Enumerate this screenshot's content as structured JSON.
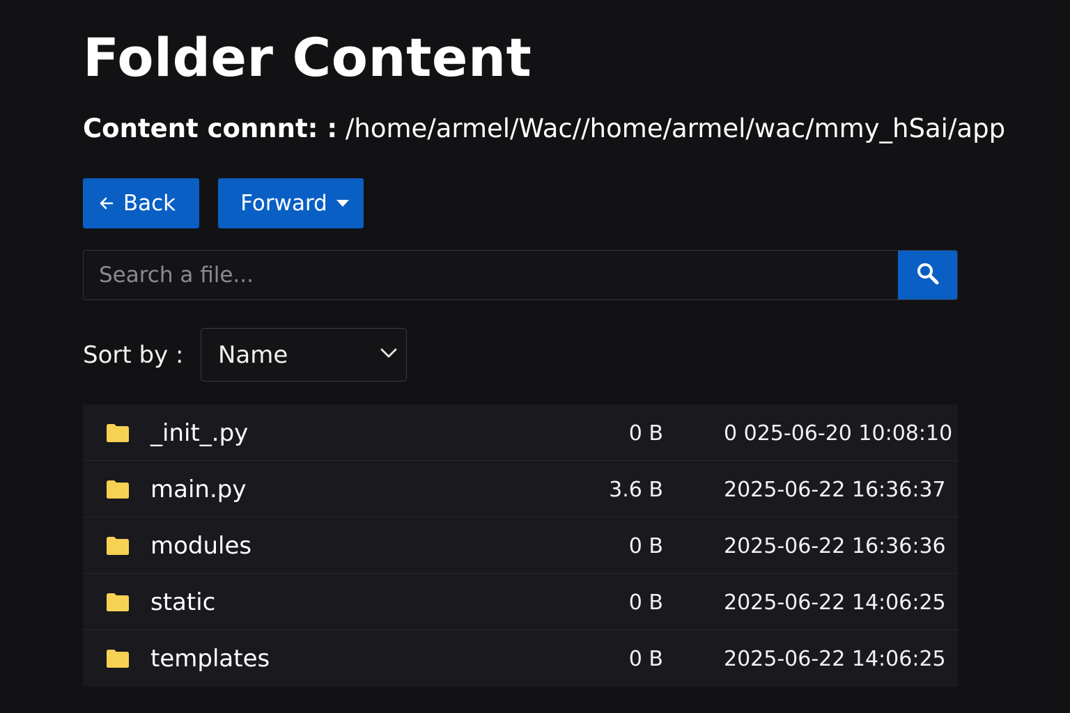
{
  "title": "Folder Content",
  "path": {
    "label": "Content connnt: :",
    "value": "/home/armel/Wac//home/armel/wac/mmy_hSai/app"
  },
  "nav": {
    "back_label": "Back",
    "forward_label": "Forward"
  },
  "search": {
    "placeholder": "Search a file...",
    "value": ""
  },
  "sort": {
    "label": "Sort by :",
    "selected": "Name"
  },
  "files": [
    {
      "icon": "folder-icon",
      "name": "_init_.py",
      "size": "0 B",
      "modified": "0 025-06-20 10:08:10"
    },
    {
      "icon": "folder-icon",
      "name": "main.py",
      "size": "3.6 B",
      "modified": "2025-06-22 16:36:37"
    },
    {
      "icon": "folder-icon",
      "name": "modules",
      "size": "0 B",
      "modified": "2025-06-22 16:36:36"
    },
    {
      "icon": "folder-icon",
      "name": "static",
      "size": "0 B",
      "modified": "2025-06-22 14:06:25"
    },
    {
      "icon": "folder-icon",
      "name": "templates",
      "size": "0 B",
      "modified": "2025-06-22 14:06:25"
    }
  ],
  "colors": {
    "background": "#121215",
    "accent": "#0a5fc4",
    "folder": "#f7d154",
    "list_background": "#19191e"
  }
}
